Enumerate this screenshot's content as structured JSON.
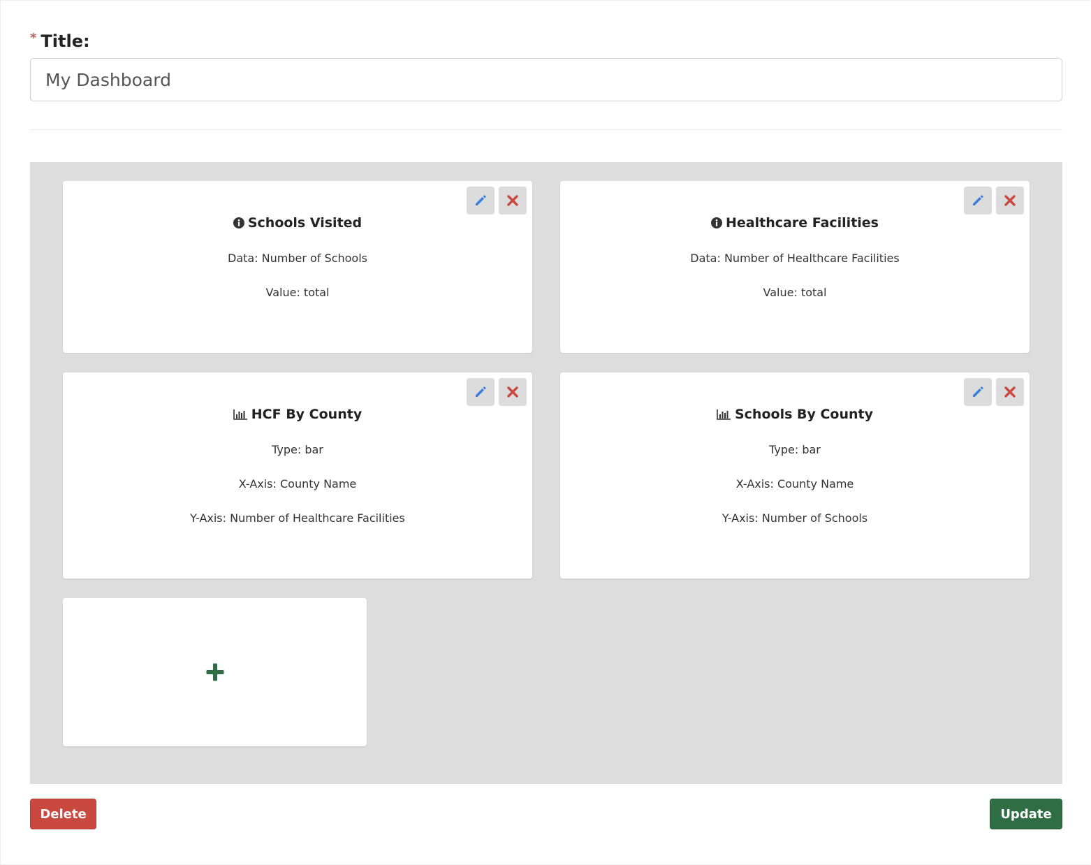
{
  "form": {
    "required_mark": "*",
    "title_label": "Title:",
    "title_value": "My Dashboard"
  },
  "colors": {
    "edit_icon": "#3b7ddd",
    "remove_icon": "#c9483f",
    "add_icon": "#2f6e44",
    "delete_button": "#c9483f",
    "update_button": "#2f6e44",
    "panel_background": "#dddddd"
  },
  "cards": [
    {
      "icon": "info-circle-icon",
      "title": "Schools Visited",
      "lines": [
        "Data: Number of Schools",
        "Value: total"
      ]
    },
    {
      "icon": "info-circle-icon",
      "title": "Healthcare Facilities",
      "lines": [
        "Data: Number of Healthcare Facilities",
        "Value: total"
      ]
    },
    {
      "icon": "bar-chart-icon",
      "title": "HCF By County",
      "lines": [
        "Type: bar",
        "X-Axis: County Name",
        "Y-Axis: Number of Healthcare Facilities"
      ]
    },
    {
      "icon": "bar-chart-icon",
      "title": "Schools By County",
      "lines": [
        "Type: bar",
        "X-Axis: County Name",
        "Y-Axis: Number of Schools"
      ]
    }
  ],
  "add_card": {
    "icon": "plus-icon"
  },
  "actions": {
    "delete_label": "Delete",
    "update_label": "Update"
  }
}
